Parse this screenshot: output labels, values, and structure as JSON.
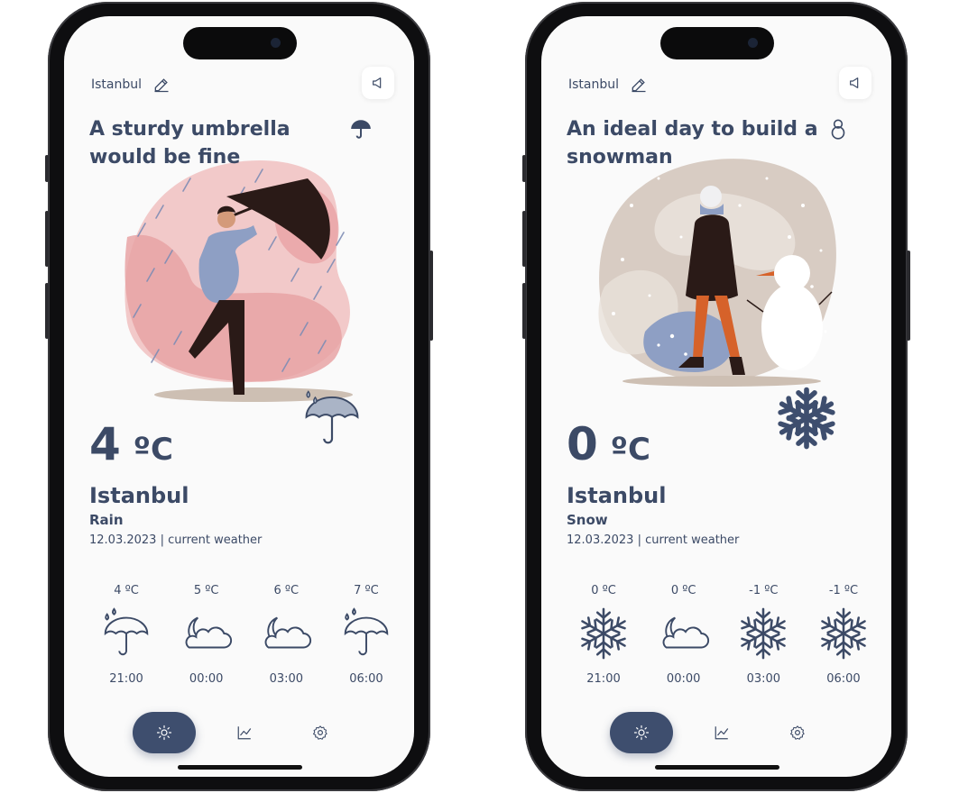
{
  "screens": [
    {
      "location": "Istanbul",
      "headline": "A sturdy umbrella would be fine",
      "headline_icon": "umbrella-icon",
      "illustration": "man-with-umbrella-in-rain",
      "big_icon": "umbrella-rain-icon",
      "temperature": "4",
      "unit": "ºC",
      "city": "Istanbul",
      "condition": "Rain",
      "date_line": "12.03.2023 | current weather",
      "forecast": [
        {
          "temp": "4 ºC",
          "time": "21:00",
          "icon": "umbrella-rain-icon"
        },
        {
          "temp": "5 ºC",
          "time": "00:00",
          "icon": "moon-cloud-icon"
        },
        {
          "temp": "6 ºC",
          "time": "03:00",
          "icon": "moon-cloud-icon"
        },
        {
          "temp": "7 ºC",
          "time": "06:00",
          "icon": "umbrella-rain-icon"
        }
      ],
      "nav": {
        "active": "sun-icon",
        "items": [
          "chart-icon",
          "gear-icon"
        ]
      }
    },
    {
      "location": "Istanbul",
      "headline": "An ideal day to build a snowman",
      "headline_icon": "snowman-icon",
      "illustration": "woman-walking-in-snow-with-snowman",
      "big_icon": "snowflake-icon",
      "temperature": "0",
      "unit": "ºC",
      "city": "Istanbul",
      "condition": "Snow",
      "date_line": "12.03.2023 | current weather",
      "forecast": [
        {
          "temp": "0 ºC",
          "time": "21:00",
          "icon": "snowflake-icon"
        },
        {
          "temp": "0 ºC",
          "time": "00:00",
          "icon": "moon-cloud-icon"
        },
        {
          "temp": "-1 ºC",
          "time": "03:00",
          "icon": "snowflake-icon"
        },
        {
          "temp": "-1 ºC",
          "time": "06:00",
          "icon": "snowflake-icon"
        }
      ],
      "nav": {
        "active": "sun-icon",
        "items": [
          "chart-icon",
          "gear-icon"
        ]
      }
    }
  ],
  "colors": {
    "primary": "#3c4a66",
    "nav_active": "#3e4e6e",
    "rain_blob": "#f2c9c9",
    "rain_accent": "#e8a3a5",
    "snow_blob": "#d8ccc3",
    "icon_fill": "#aab4c6",
    "frame": "#0e0e10"
  }
}
